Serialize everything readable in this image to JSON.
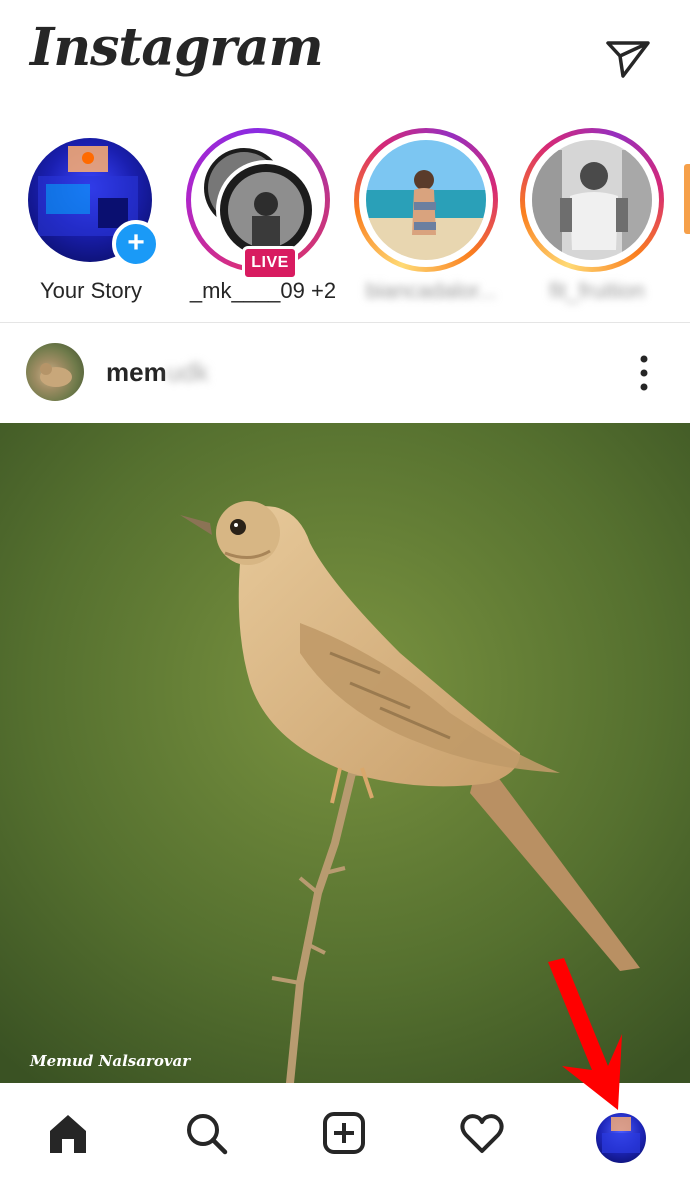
{
  "header": {
    "logo": "Instagram",
    "dm_icon": "paper-plane-icon"
  },
  "stories": [
    {
      "label": "Your Story",
      "add_icon": "+",
      "blurred": false
    },
    {
      "label": "_mk____09 +2",
      "badge": "LIVE",
      "blurred": false
    },
    {
      "label": "biancadalor...",
      "blurred": true
    },
    {
      "label": "fit_fruition",
      "blurred": true
    }
  ],
  "post": {
    "username_visible": "mem",
    "username_blurred": "udk",
    "more_icon": "more-vertical-icon",
    "watermark": "Memud Nalsarovar"
  },
  "bottom_nav": {
    "items": [
      "home-icon",
      "search-icon",
      "plus-square-icon",
      "heart-icon",
      "profile-avatar"
    ]
  },
  "colors": {
    "live": "#d81b60",
    "add_badge": "#1a9af7",
    "arrow": "#ff0000"
  }
}
